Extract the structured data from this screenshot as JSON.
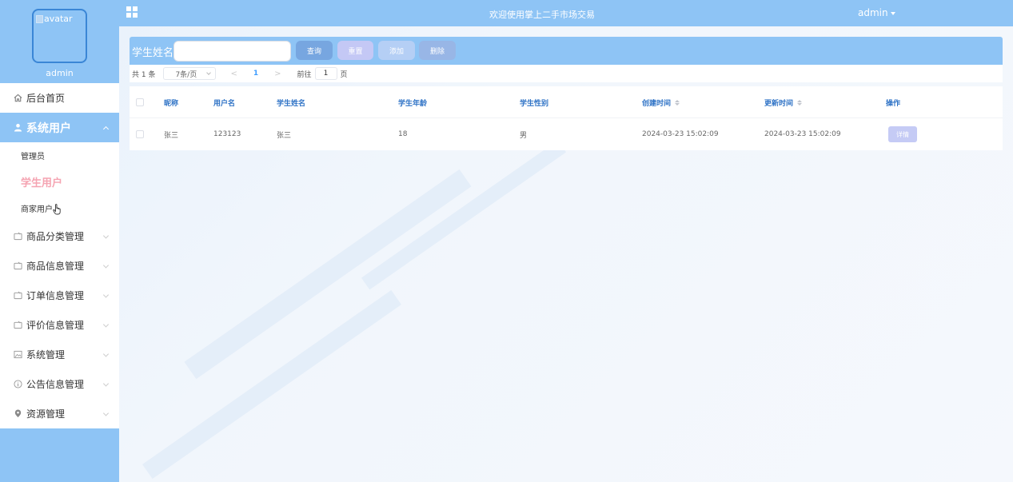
{
  "profile": {
    "avatar_alt": "avatar",
    "name": "admin"
  },
  "topbar": {
    "title": "欢迎使用掌上二手市场交易",
    "user": "admin"
  },
  "sidebar": {
    "home": {
      "label": "后台首页",
      "icon": "home-icon"
    },
    "system_users": {
      "label": "系统用户",
      "icon": "user-icon",
      "children": [
        {
          "label": "管理员"
        },
        {
          "label": "学生用户"
        },
        {
          "label": "商家用户"
        }
      ]
    },
    "items": [
      {
        "label": "商品分类管理",
        "icon": "folder-icon"
      },
      {
        "label": "商品信息管理",
        "icon": "folder-icon"
      },
      {
        "label": "订单信息管理",
        "icon": "folder-icon"
      },
      {
        "label": "评价信息管理",
        "icon": "folder-icon"
      },
      {
        "label": "系统管理",
        "icon": "image-icon"
      },
      {
        "label": "公告信息管理",
        "icon": "info-icon"
      },
      {
        "label": "资源管理",
        "icon": "location-icon"
      }
    ]
  },
  "search": {
    "label": "学生姓名",
    "value": "",
    "buttons": {
      "query": "查询",
      "reset": "重置",
      "add": "添加",
      "delete": "删除"
    }
  },
  "pagination": {
    "total": "共 1 条",
    "page_size": "7条/页",
    "prev": "<",
    "current_page": "1",
    "next": ">",
    "goto_label": "前往",
    "goto_value": "1",
    "goto_unit": "页"
  },
  "table": {
    "headers": [
      "昵称",
      "用户名",
      "学生姓名",
      "学生年龄",
      "学生性别",
      "创建时间",
      "更新时间",
      "操作"
    ],
    "rows": [
      {
        "nickname": "张三",
        "username": "123123",
        "name": "张三",
        "age": "18",
        "gender": "男",
        "created": "2024-03-23 15:02:09",
        "updated": "2024-03-23 15:02:09",
        "action": "详情"
      }
    ]
  },
  "colors": {
    "accent": "#8ec4f5",
    "active_text": "#f5a4b2",
    "header_text": "#2f73c6"
  }
}
